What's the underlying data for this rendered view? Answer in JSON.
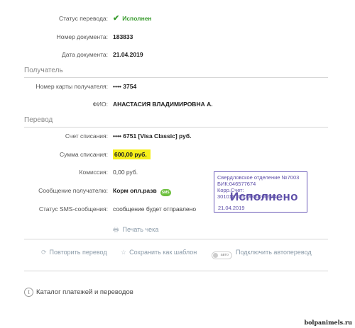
{
  "details": {
    "status_label": "Статус перевода:",
    "status_value": "Исполнен",
    "doc_number_label": "Номер документа:",
    "doc_number_value": "183833",
    "doc_date_label": "Дата документа:",
    "doc_date_value": "21.04.2019"
  },
  "recipient": {
    "section_title": "Получатель",
    "card_label": "Номер карты получателя:",
    "card_value": "•••• 3754",
    "fio_label": "ФИО:",
    "fio_value": "АНАСТАСИЯ ВЛАДИМИРОВНА А."
  },
  "transfer": {
    "section_title": "Перевод",
    "account_label": "Счет списания:",
    "account_value": "•••• 6751  [Visa Classic]  руб.",
    "amount_label": "Сумма списания:",
    "amount_value": "600,00  руб.",
    "commission_label": "Комиссия:",
    "commission_value": "0,00 руб.",
    "message_label": "Сообщение получателю:",
    "message_value": "Корм опл.разв",
    "message_icon_text": "SMS",
    "sms_status_label": "Статус SMS-сообщения:",
    "sms_status_value": "сообщение будет отправлено",
    "print_label": "Печать чека"
  },
  "stamp": {
    "line1": "Свердловское отделение №7003",
    "line2": "БИК:046577674",
    "line3": "Корр.Счет: 30101810500000000674",
    "big_text": "Исполнено",
    "date": "21.04.2019"
  },
  "actions": {
    "repeat": "Повторить перевод",
    "save_template": "Сохранить как шаблон",
    "auto_toggle": "авто",
    "autotransfer": "Подключить автоперевод"
  },
  "catalog": {
    "label": "Каталог платежей и переводов"
  },
  "watermark": "bolpanimels.ru",
  "colors": {
    "success_green": "#3a9c2f",
    "highlight_yellow": "#f6ef1a",
    "stamp_purple": "#5d4ea8",
    "action_gray": "#8a9aa8"
  }
}
